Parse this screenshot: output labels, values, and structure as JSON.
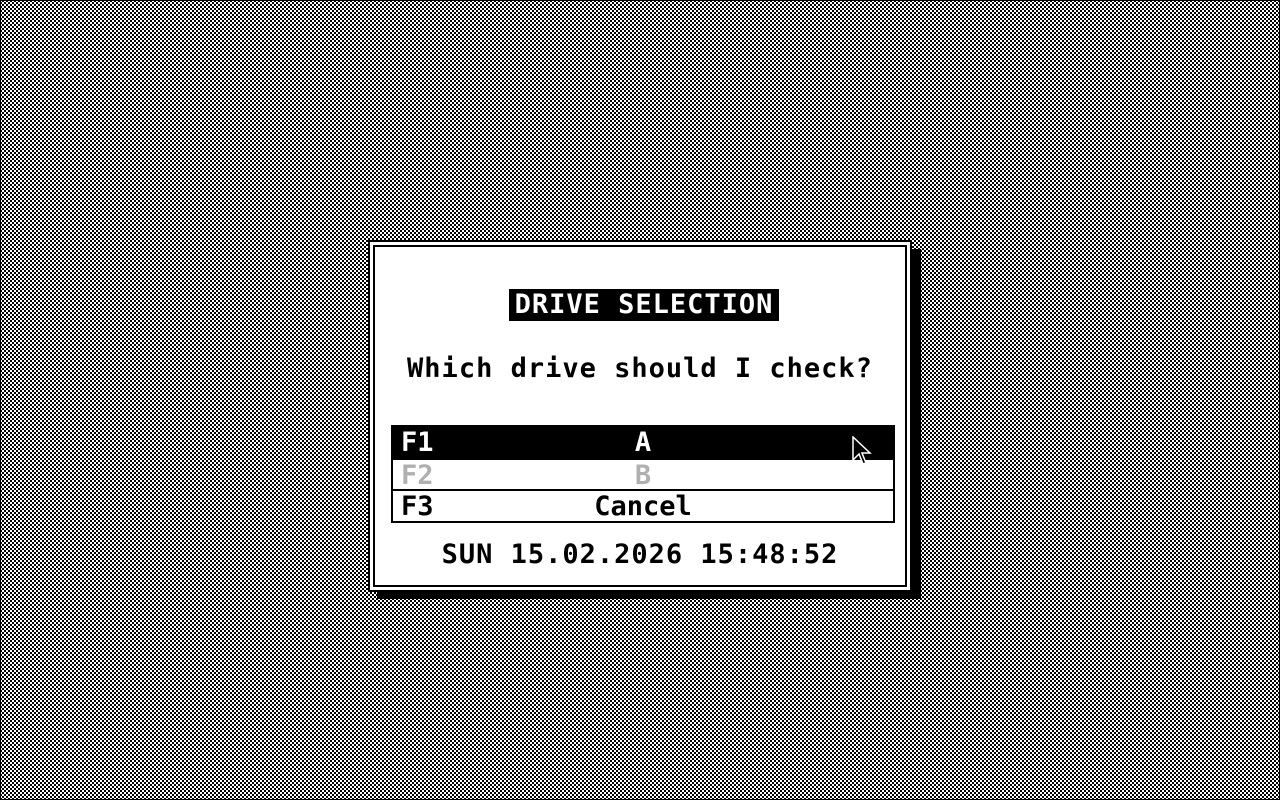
{
  "dialog": {
    "title": "DRIVE SELECTION",
    "question": "Which drive should I check?",
    "options": [
      {
        "key": "F1",
        "label": "A",
        "state": "selected"
      },
      {
        "key": "F2",
        "label": "B",
        "state": "disabled"
      },
      {
        "key": "F3",
        "label": "Cancel",
        "state": "normal"
      }
    ],
    "datetime": "SUN 15.02.2026 15:48:52"
  },
  "cursor": {
    "icon": "arrow-pointer-icon"
  },
  "colors": {
    "foreground": "#000000",
    "background": "#ffffff",
    "disabled": "#b0b0b0"
  }
}
